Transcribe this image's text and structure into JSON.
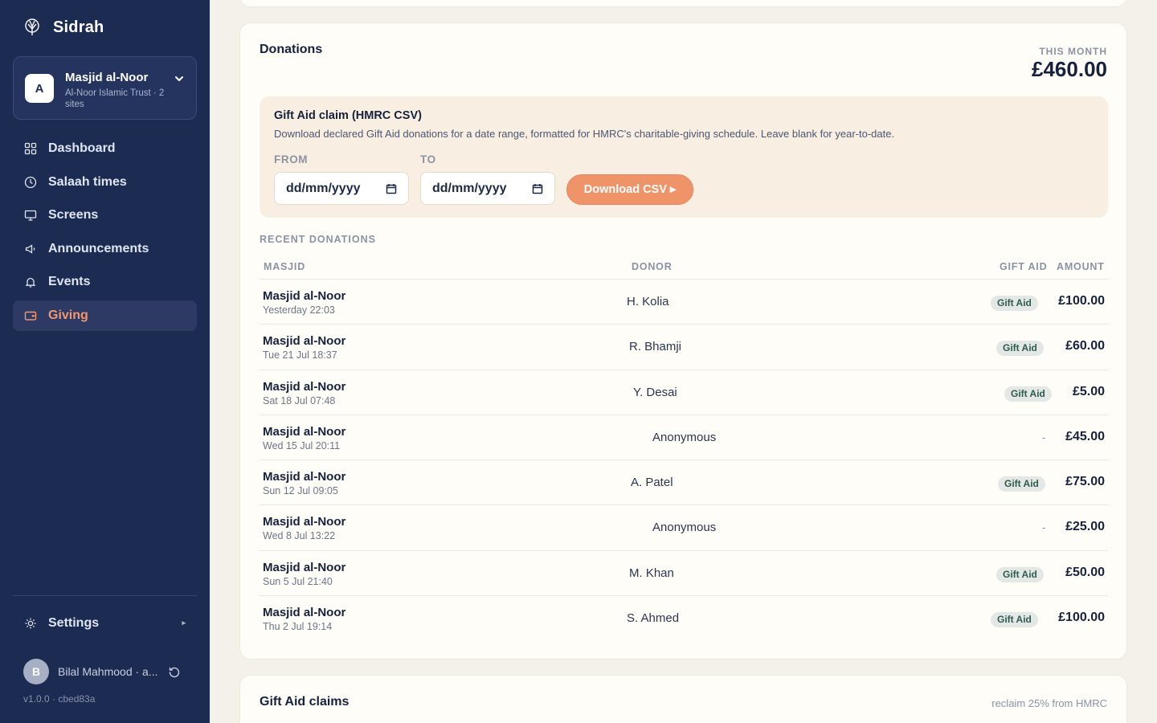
{
  "app": {
    "name": "Sidrah"
  },
  "org": {
    "avatar_letter": "A",
    "name": "Masjid al-Noor",
    "subtitle": "Al-Noor Islamic Trust · 2 sites"
  },
  "nav": {
    "items": [
      {
        "label": "Dashboard",
        "icon": "grid-icon"
      },
      {
        "label": "Salaah times",
        "icon": "clock-icon"
      },
      {
        "label": "Screens",
        "icon": "monitor-icon"
      },
      {
        "label": "Announcements",
        "icon": "megaphone-icon"
      },
      {
        "label": "Events",
        "icon": "bell-icon"
      },
      {
        "label": "Giving",
        "icon": "wallet-icon",
        "active": true
      }
    ],
    "settings_label": "Settings"
  },
  "user": {
    "avatar_letter": "B",
    "name": "Bilal Mahmood · a...",
    "version": "v1.0.0 · cbed83a"
  },
  "donations": {
    "title": "Donations",
    "month_label": "THIS MONTH",
    "month_value": "£460.00",
    "gift_aid": {
      "title": "Gift Aid claim (HMRC CSV)",
      "description": "Download declared Gift Aid donations for a date range, formatted for HMRC's charitable-giving schedule. Leave blank for year-to-date.",
      "from_label": "FROM",
      "to_label": "TO",
      "from_placeholder": "dd/mm/yyyy",
      "to_placeholder": "dd/mm/yyyy",
      "download_label": "Download CSV ▸"
    },
    "recent_label": "RECENT DONATIONS",
    "columns": {
      "masjid": "MASJID",
      "donor": "DONOR",
      "gift_aid": "GIFT AID",
      "amount": "AMOUNT"
    },
    "rows": [
      {
        "masjid": "Masjid al-Noor",
        "time": "Yesterday 22:03",
        "donor": "H. Kolia",
        "gift_aid": "Gift Aid",
        "amount": "£100.00"
      },
      {
        "masjid": "Masjid al-Noor",
        "time": "Tue 21 Jul 18:37",
        "donor": "R. Bhamji",
        "gift_aid": "Gift Aid",
        "amount": "£60.00"
      },
      {
        "masjid": "Masjid al-Noor",
        "time": "Sat 18 Jul 07:48",
        "donor": "Y. Desai",
        "gift_aid": "Gift Aid",
        "amount": "£5.00"
      },
      {
        "masjid": "Masjid al-Noor",
        "time": "Wed 15 Jul 20:11",
        "donor": "Anonymous",
        "gift_aid": "-",
        "amount": "£45.00"
      },
      {
        "masjid": "Masjid al-Noor",
        "time": "Sun 12 Jul 09:05",
        "donor": "A. Patel",
        "gift_aid": "Gift Aid",
        "amount": "£75.00"
      },
      {
        "masjid": "Masjid al-Noor",
        "time": "Wed 8 Jul 13:22",
        "donor": "Anonymous",
        "gift_aid": "-",
        "amount": "£25.00"
      },
      {
        "masjid": "Masjid al-Noor",
        "time": "Sun 5 Jul 21:40",
        "donor": "M. Khan",
        "gift_aid": "Gift Aid",
        "amount": "£50.00"
      },
      {
        "masjid": "Masjid al-Noor",
        "time": "Thu 2 Jul 19:14",
        "donor": "S. Ahmed",
        "gift_aid": "Gift Aid",
        "amount": "£100.00"
      }
    ]
  },
  "gift_aid_claims": {
    "title": "Gift Aid claims",
    "note": "reclaim 25% from HMRC"
  },
  "colors": {
    "sidebar": "#1c2b51",
    "accent": "#ef9468",
    "background": "#f4f1ea"
  }
}
